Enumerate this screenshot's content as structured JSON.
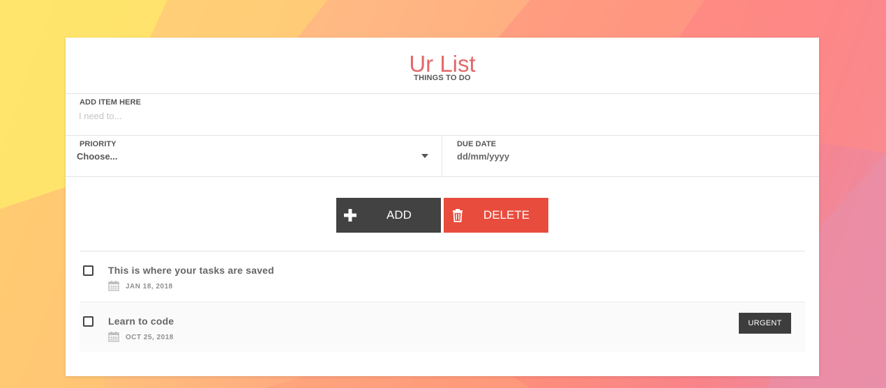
{
  "app": {
    "title": "Ur List",
    "subtitle": "THINGS TO DO"
  },
  "form": {
    "item_label": "ADD ITEM HERE",
    "item_placeholder": "I need to...",
    "item_value": "",
    "priority_label": "PRIORITY",
    "priority_selected": "Choose...",
    "due_label": "DUE DATE",
    "due_value": "dd/mm/yyyy"
  },
  "actions": {
    "add_label": "ADD",
    "delete_label": "DELETE"
  },
  "tasks": [
    {
      "name": "This is where your tasks are saved",
      "date": "JAN 18, 2018",
      "checked": false,
      "badge": ""
    },
    {
      "name": "Learn to code",
      "date": "OCT 25, 2018",
      "checked": false,
      "badge": "URGENT"
    }
  ],
  "icons": {
    "add": "plus-icon",
    "delete": "trash-icon",
    "date": "calendar-icon",
    "select": "caret-down-icon"
  },
  "colors": {
    "title": "#e5686a",
    "add_button": "#424242",
    "delete_button": "#e84c3d",
    "badge": "#3d3d3d"
  }
}
